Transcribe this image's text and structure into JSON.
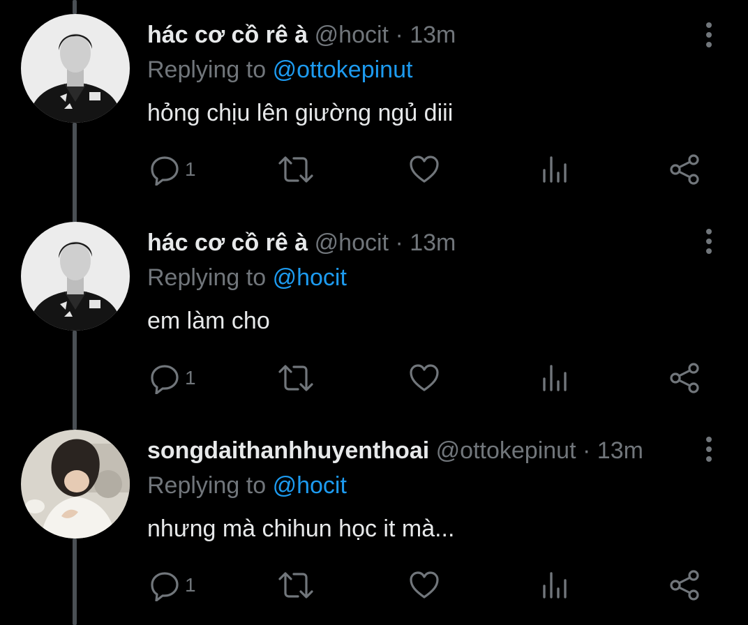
{
  "colors": {
    "background": "#000000",
    "text": "#e7e9ea",
    "muted": "#71767b",
    "link": "#1d9bf0",
    "thread_line": "#4a4f54"
  },
  "tweets": [
    {
      "name": "hác cơ cồ rê à",
      "handle": "@hocit",
      "dot": "·",
      "time": "13m",
      "replying_prefix": "Replying to",
      "replying_to": "@ottokepinut",
      "text": "hỏng chịu lên giường ngủ diii",
      "reply_count": "1",
      "avatar": "avatar-photo-grayscale",
      "icons": [
        "reply-icon",
        "retweet-icon",
        "like-icon",
        "views-icon",
        "share-icon",
        "more-icon"
      ]
    },
    {
      "name": "hác cơ cồ rê à",
      "handle": "@hocit",
      "dot": "·",
      "time": "13m",
      "replying_prefix": "Replying to",
      "replying_to": "@hocit",
      "text": "em làm cho",
      "reply_count": "1",
      "avatar": "avatar-photo-grayscale",
      "icons": [
        "reply-icon",
        "retweet-icon",
        "like-icon",
        "views-icon",
        "share-icon",
        "more-icon"
      ]
    },
    {
      "name": "songdaithanhhuyenthoai",
      "handle": "@ottokepinut",
      "dot": "·",
      "time": "13m",
      "replying_prefix": "Replying to",
      "replying_to": "@hocit",
      "text": "nhưng mà chihun học it mà...",
      "reply_count": "1",
      "avatar": "avatar-photo-light",
      "icons": [
        "reply-icon",
        "retweet-icon",
        "like-icon",
        "views-icon",
        "share-icon",
        "more-icon"
      ]
    }
  ]
}
